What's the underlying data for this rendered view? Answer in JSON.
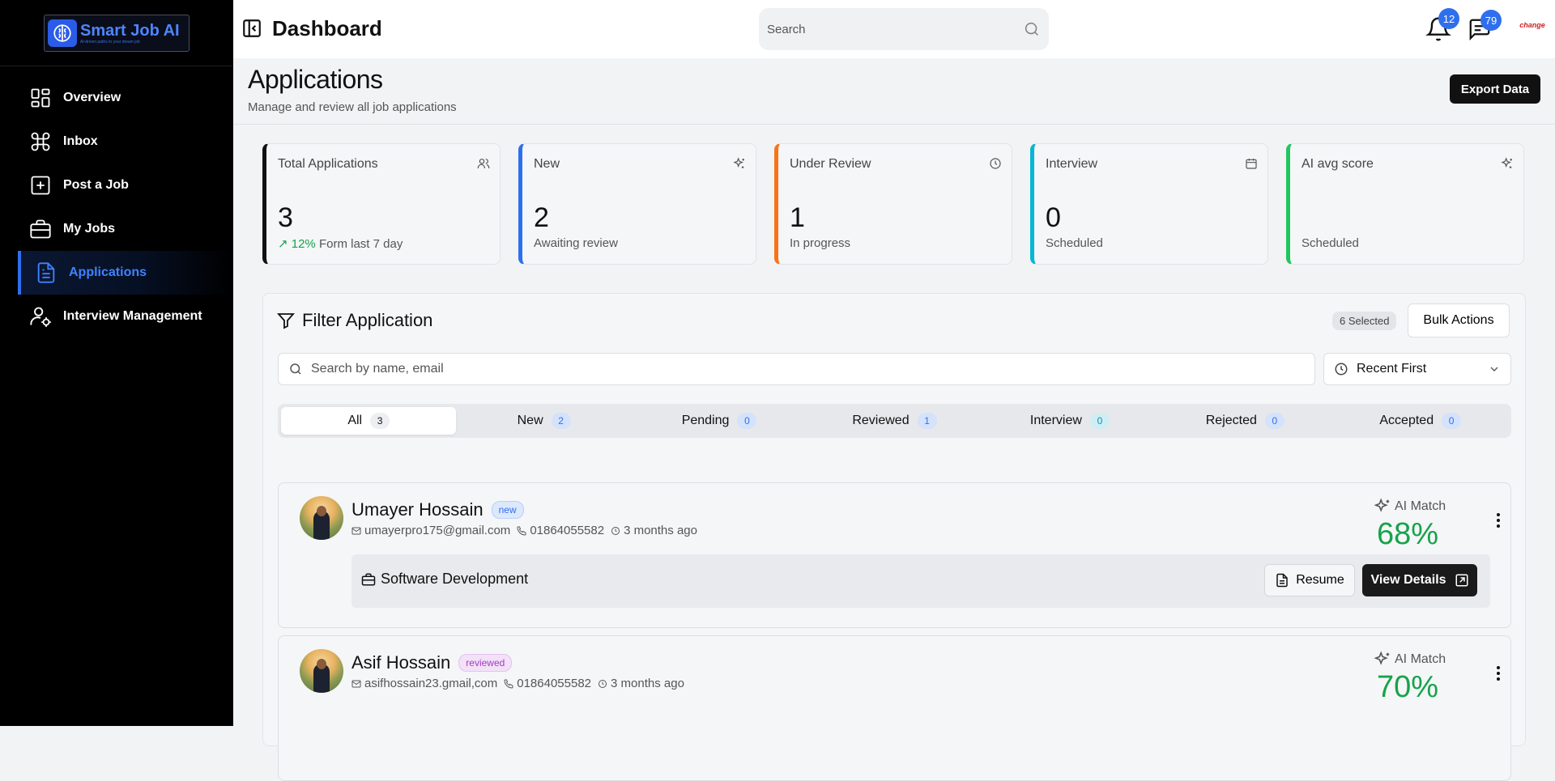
{
  "brand": {
    "name": "Smart Job AI",
    "tagline": "AI-driven paths to your dream job"
  },
  "sidebar": {
    "items": [
      {
        "label": "Overview",
        "icon": "grid-icon"
      },
      {
        "label": "Inbox",
        "icon": "command-icon"
      },
      {
        "label": "Post a Job",
        "icon": "plus-square-icon"
      },
      {
        "label": "My Jobs",
        "icon": "briefcase-icon"
      },
      {
        "label": "Applications",
        "icon": "document-icon",
        "active": true
      },
      {
        "label": "Interview Management",
        "icon": "user-gear-icon"
      }
    ]
  },
  "topbar": {
    "title": "Dashboard",
    "search_placeholder": "Search",
    "notifications_count": "12",
    "messages_count": "79",
    "avatar_text": "change"
  },
  "page": {
    "title": "Applications",
    "subtitle": "Manage and review all job applications",
    "export_label": "Export Data"
  },
  "stats": [
    {
      "label": "Total Applications",
      "value": "3",
      "trend": "12%",
      "sub": "Form last 7 day",
      "color": "#111111",
      "icon": "users-icon"
    },
    {
      "label": "New",
      "value": "2",
      "sub": "Awaiting review",
      "color": "#2f6fee",
      "icon": "sparkles-icon"
    },
    {
      "label": "Under Review",
      "value": "1",
      "sub": "In progress",
      "color": "#f97316",
      "icon": "clock-icon"
    },
    {
      "label": "Interview",
      "value": "0",
      "sub": "Scheduled",
      "color": "#06b6d4",
      "icon": "calendar-icon"
    },
    {
      "label": "AI avg score",
      "value": "",
      "sub": "Scheduled",
      "color": "#22c55e",
      "icon": "sparkles-icon"
    }
  ],
  "filter": {
    "title": "Filter Application",
    "selected_label": "6 Selected",
    "bulk_label": "Bulk Actions",
    "search_placeholder": "Search by name, email",
    "sort_label": "Recent First",
    "tabs": [
      {
        "label": "All",
        "count": "3",
        "active": true
      },
      {
        "label": "New",
        "count": "2"
      },
      {
        "label": "Pending",
        "count": "0"
      },
      {
        "label": "Reviewed",
        "count": "1"
      },
      {
        "label": "Interview",
        "count": "0"
      },
      {
        "label": "Rejected",
        "count": "0"
      },
      {
        "label": "Accepted",
        "count": "0"
      }
    ]
  },
  "applications": [
    {
      "name": "Umayer Hossain",
      "status": "new",
      "email": "umayerpro175@gmail.com",
      "phone": "01864055582",
      "time": "3 months ago",
      "ai_label": "AI Match",
      "score": "68%",
      "job": "Software Development",
      "resume_label": "Resume",
      "view_label": "View Details"
    },
    {
      "name": "Asif Hossain",
      "status": "reviewed",
      "email": "asifhossain23.gmail,com",
      "phone": "01864055582",
      "time": "3 months ago",
      "ai_label": "AI Match",
      "score": "70%"
    }
  ],
  "colors": {
    "accent": "#2f6fee",
    "success": "#16a34a",
    "dark": "#111111"
  }
}
